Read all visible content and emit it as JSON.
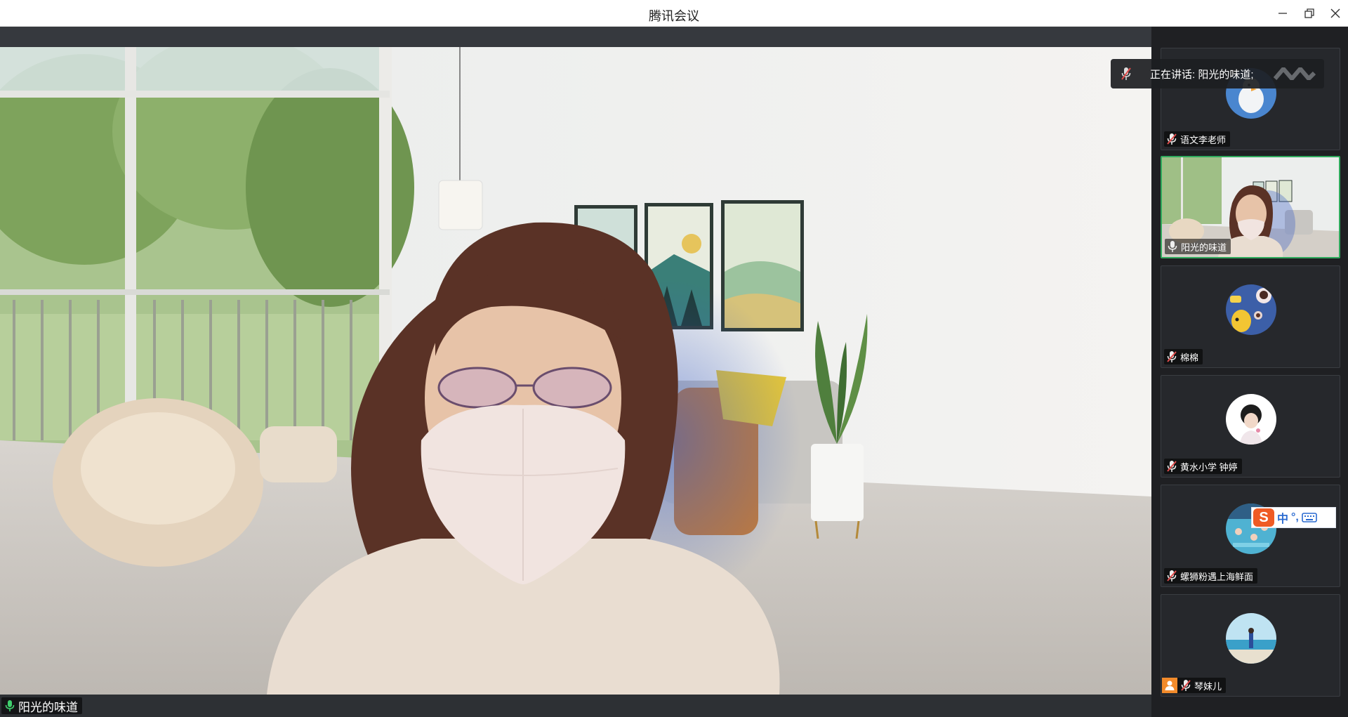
{
  "window": {
    "title": "腾讯会议"
  },
  "stage": {
    "speaker_name": "阳光的味道"
  },
  "toast": {
    "speaking_label": "正在讲话: 阳光的味道;"
  },
  "participants": [
    {
      "name": "语文李老师",
      "mic": "muted",
      "active": false
    },
    {
      "name": "阳光的味道",
      "mic": "on",
      "active": true
    },
    {
      "name": "棉棉",
      "mic": "muted",
      "active": false
    },
    {
      "name": "黄水小学 钟婷",
      "mic": "muted",
      "active": false
    },
    {
      "name": "螺狮粉遇上海鲜面",
      "mic": "muted",
      "active": false
    },
    {
      "name": "琴妹儿",
      "mic": "muted",
      "active": false,
      "host": true
    }
  ],
  "ime": {
    "logo": "S",
    "mode": "中",
    "punct": "°,"
  },
  "colors": {
    "active_border": "#2faa5d",
    "host_badge": "#f28b2b",
    "muted_red": "#e04b4b",
    "ime_logo": "#ef5b25"
  },
  "icons": {
    "minimize": "minimize-icon",
    "restore": "restore-icon",
    "close": "close-icon",
    "mic_on": "mic-icon",
    "mic_muted": "mic-muted-icon",
    "host": "host-icon",
    "keyboard": "keyboard-icon"
  }
}
